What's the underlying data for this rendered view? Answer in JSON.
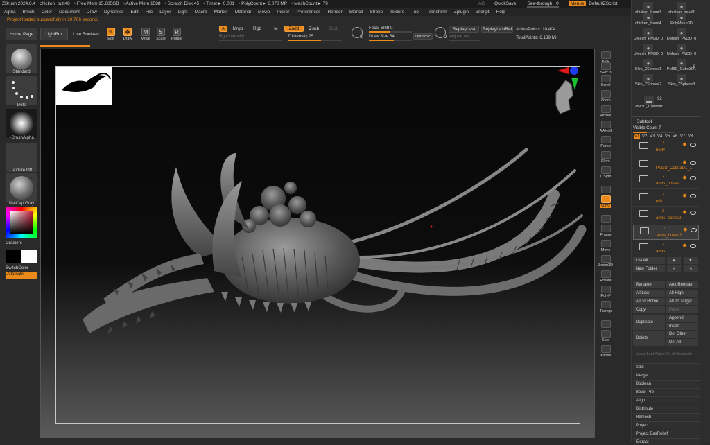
{
  "titlebar": {
    "app": "ZBrush 2024.0.4",
    "file": "chicken_butt48",
    "free_mem": "• Free Mem 15.685GB",
    "active_mem": "• Active Mem 1588",
    "scratch": "• Scratch Disk 45",
    "timer": "• Timer► 0.001",
    "polycount": "• PolyCount► 6.078 MP",
    "meshcount": "• MeshCount► 79"
  },
  "topright": {
    "ac": "AC",
    "quicksave": "QuickSave",
    "seethrough": "See-through",
    "seethrough_val": "0",
    "menus": "Menus",
    "script": "DefaultZScript",
    "seethrough_level": 0.0
  },
  "menubar": [
    "Alpha",
    "Brush",
    "Color",
    "Document",
    "Draw",
    "Dynamics",
    "Edit",
    "File",
    "Layer",
    "Light",
    "Macro",
    "Marker",
    "Material",
    "Movie",
    "Picker",
    "Preferences",
    "Render",
    "Stencil",
    "Stroke",
    "Texture",
    "Tool",
    "Transform",
    "Zplugin",
    "Zscript",
    "Help"
  ],
  "notification": "Project loaded successfully in 10.706 second.",
  "toolbar": {
    "home": "Home Page",
    "lightbox": "LightBox",
    "liveboolean": "Live Boolean",
    "edit": "Edit",
    "draw": "Draw",
    "move": "Move",
    "scale": "Scale",
    "rotate": "Rotate",
    "a": "A",
    "mrgb": "Mrgb",
    "rgb": "Rgb",
    "m": "M",
    "zadd": "Zadd",
    "zsub": "Zsub",
    "zcut": "Zcut",
    "rgb_intensity": "Rgb Intensity",
    "z_intensity": "Z Intensity",
    "z_intensity_val": "25",
    "focal_shift": "Focal Shift",
    "focal_shift_val": "0",
    "draw_size": "Draw Size",
    "draw_size_val": "64",
    "dynamic": "Dynamic",
    "replaylast": "ReplayLast",
    "replaylastrel": "ReplayLastRel",
    "adjustlast": "AdjustLast",
    "active_points": "ActivePoints: 10,404",
    "total_points": "TotalPoints: 6.139 Mil",
    "s_label": "S",
    "d_label": "D"
  },
  "leftshelf": {
    "standard": "Standard",
    "dots": "Dots",
    "brushalpha": "~BrushAlpha",
    "textureoff": "Texture Off",
    "matcap": "MatCap Gray",
    "gradient": "Gradient",
    "switchcolor": "SwitchColor",
    "alternate": "Alternate"
  },
  "rightbar": [
    {
      "name": "bpr",
      "label": "BPR"
    },
    {
      "name": "spix",
      "label": "SPix 3"
    },
    {
      "name": "scroll",
      "label": "Scroll"
    },
    {
      "name": "zoom",
      "label": "Zoom"
    },
    {
      "name": "actual",
      "label": "Actual"
    },
    {
      "name": "aahalf",
      "label": "AAHalf"
    },
    {
      "name": "persp",
      "label": "Persp"
    },
    {
      "name": "floor",
      "label": "Floor"
    },
    {
      "name": "lsym",
      "label": "L.Sym"
    },
    {
      "name": "lock",
      "label": ""
    },
    {
      "name": "xyz",
      "label": "Qxyz"
    },
    {
      "name": "rot",
      "label": ""
    },
    {
      "name": "frame",
      "label": "Frame"
    },
    {
      "name": "move",
      "label": "Move"
    },
    {
      "name": "zoom3d",
      "label": "Zoom3D"
    },
    {
      "name": "rotate",
      "label": "Rotate"
    },
    {
      "name": "polyf",
      "label": "PolyF"
    },
    {
      "name": "transp",
      "label": "Transp"
    },
    {
      "name": "ghost",
      "label": ""
    },
    {
      "name": "solo",
      "label": "Solo"
    },
    {
      "name": "xpose",
      "label": "Xpose"
    }
  ],
  "palette": {
    "tools": [
      "chicken_head4",
      "chicken_head4",
      "chicken_head4",
      "PolyMesh3D",
      "UMesh_PM3D_0",
      "UMesh_PM3D_0",
      "UMesh_PM3D_0",
      "UMesh_PM3D_0",
      "Skin_ZSphere1",
      "PM3D_Cube3D1",
      "Skin_ZSphere2",
      "Skin_ZSphere3"
    ],
    "tools_count5": "5",
    "cylinder_count": "92",
    "cylinder": "PM3D_Cylinder",
    "subtool_header": "Subtool",
    "visible_count": "Visible Count",
    "visible_count_val": "7",
    "versions": [
      "V1",
      "V2",
      "V3",
      "V4",
      "V5",
      "V6",
      "V7",
      "V8"
    ],
    "subtools": [
      {
        "name": "body",
        "count": "4"
      },
      {
        "name": "PM3D_Cube3D1_1",
        "count": ""
      },
      {
        "name": "arms_bones",
        "count": "2"
      },
      {
        "name": "edit",
        "count": "2"
      },
      {
        "name": "arms_bones2",
        "count": "3"
      },
      {
        "name": "arms_bones2",
        "count": "2"
      },
      {
        "name": "arms",
        "count": "2"
      }
    ],
    "list_all": "List All",
    "new_folder": "New Folder",
    "rename": "Rename",
    "autoreorder": "AutoReorder",
    "all_low": "All Low",
    "all_high": "All High",
    "all_to_home": "All To Home",
    "all_to_target": "All To Target",
    "copy": "Copy",
    "paste": "Paste",
    "duplicate": "Duplicate",
    "append": "Append",
    "insert": "Insert",
    "delete": "Delete",
    "del_other": "Del Other",
    "del_all": "Del All",
    "apply_last": "Apply Last Action To All Subtools",
    "sections": [
      "Split",
      "Merge",
      "Boolean",
      "Bevel Pro",
      "Align",
      "Distribute",
      "Remesh",
      "Project",
      "Project BasRelief",
      "Extract"
    ]
  },
  "colors": {
    "accent": "#e98a1b",
    "bg": "#2a2a2a",
    "viewport_top": "#060606"
  }
}
